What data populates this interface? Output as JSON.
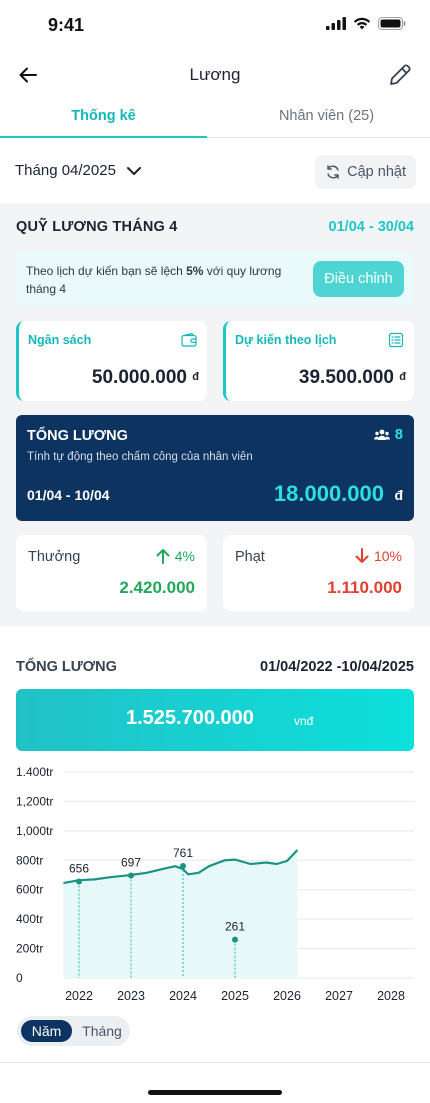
{
  "status_bar": {
    "time": "9:41"
  },
  "nav": {
    "title": "Lương",
    "back_icon": "arrow-left-icon",
    "edit_icon": "pencil-icon"
  },
  "tabs": [
    {
      "label": "Thống kê",
      "active": true
    },
    {
      "label": "Nhân viên (25)",
      "active": false
    }
  ],
  "filter": {
    "month": "Tháng 04/2025",
    "refresh_label": "Cập nhật"
  },
  "fund": {
    "title": "QUỸ LƯƠNG THÁNG 4",
    "range": "01/04 - 30/04",
    "notice_prefix": "Theo lịch dự kiến bạn sẽ lệch ",
    "notice_percent": "5%",
    "notice_suffix": " với quy lương tháng 4",
    "adjust_label": "Điều chỉnh"
  },
  "budget": {
    "label": "Ngân sách",
    "value": "50.000.000",
    "unit": "đ",
    "icon": "wallet-icon"
  },
  "planned": {
    "label": "Dự kiến theo lịch",
    "value": "39.500.000",
    "unit": "đ",
    "icon": "list-icon"
  },
  "total_salary": {
    "title": "TỔNG LƯƠNG",
    "subtitle": "Tính tự động theo chấm công của nhân viên",
    "staff_count": "8",
    "period": "01/04 - 10/04",
    "amount": "18.000.000",
    "unit": "đ"
  },
  "bonus": {
    "label": "Thưởng",
    "percent": "4%",
    "value": "2.420.000",
    "trend": "up"
  },
  "penalty": {
    "label": "Phạt",
    "percent": "10%",
    "value": "1.110.000",
    "trend": "down"
  },
  "summary": {
    "title": "TỔNG LƯƠNG",
    "range": "01/04/2022 -10/04/2025",
    "total": "1.525.700.000",
    "unit": "vnđ"
  },
  "period_toggle": {
    "year_label": "Năm",
    "month_label": "Tháng",
    "selected": "Năm"
  },
  "colors": {
    "accent": "#1fc6c6",
    "navy": "#0d3461",
    "green": "#22a85a",
    "red": "#e0412f",
    "line": "#1a9482"
  },
  "chart_data": {
    "type": "area",
    "x_categories": [
      "2022",
      "2023",
      "2024",
      "2025",
      "2026",
      "2027",
      "2028"
    ],
    "y_tick_labels": [
      "0",
      "200tr",
      "400tr",
      "600tr",
      "800tr",
      "1,000tr",
      "1,200tr",
      "1.400tr"
    ],
    "ylim": [
      0,
      1400
    ],
    "grid": true,
    "line": [
      {
        "x": 2021.7,
        "y": 645
      },
      {
        "x": 2022.0,
        "y": 665
      },
      {
        "x": 2022.3,
        "y": 670
      },
      {
        "x": 2022.6,
        "y": 685
      },
      {
        "x": 2023.0,
        "y": 700
      },
      {
        "x": 2023.3,
        "y": 715
      },
      {
        "x": 2023.6,
        "y": 740
      },
      {
        "x": 2023.85,
        "y": 760
      },
      {
        "x": 2024.0,
        "y": 740
      },
      {
        "x": 2024.1,
        "y": 705
      },
      {
        "x": 2024.3,
        "y": 715
      },
      {
        "x": 2024.5,
        "y": 760
      },
      {
        "x": 2024.8,
        "y": 800
      },
      {
        "x": 2025.0,
        "y": 805
      },
      {
        "x": 2025.3,
        "y": 775
      },
      {
        "x": 2025.6,
        "y": 785
      },
      {
        "x": 2025.8,
        "y": 775
      },
      {
        "x": 2026.0,
        "y": 795
      },
      {
        "x": 2026.2,
        "y": 870
      }
    ],
    "points": [
      {
        "x": 2022.0,
        "y": 656,
        "label": "656"
      },
      {
        "x": 2023.0,
        "y": 697,
        "label": "697"
      },
      {
        "x": 2024.0,
        "y": 761,
        "label": "761"
      },
      {
        "x": 2025.0,
        "y": 261,
        "label": "261"
      }
    ]
  }
}
